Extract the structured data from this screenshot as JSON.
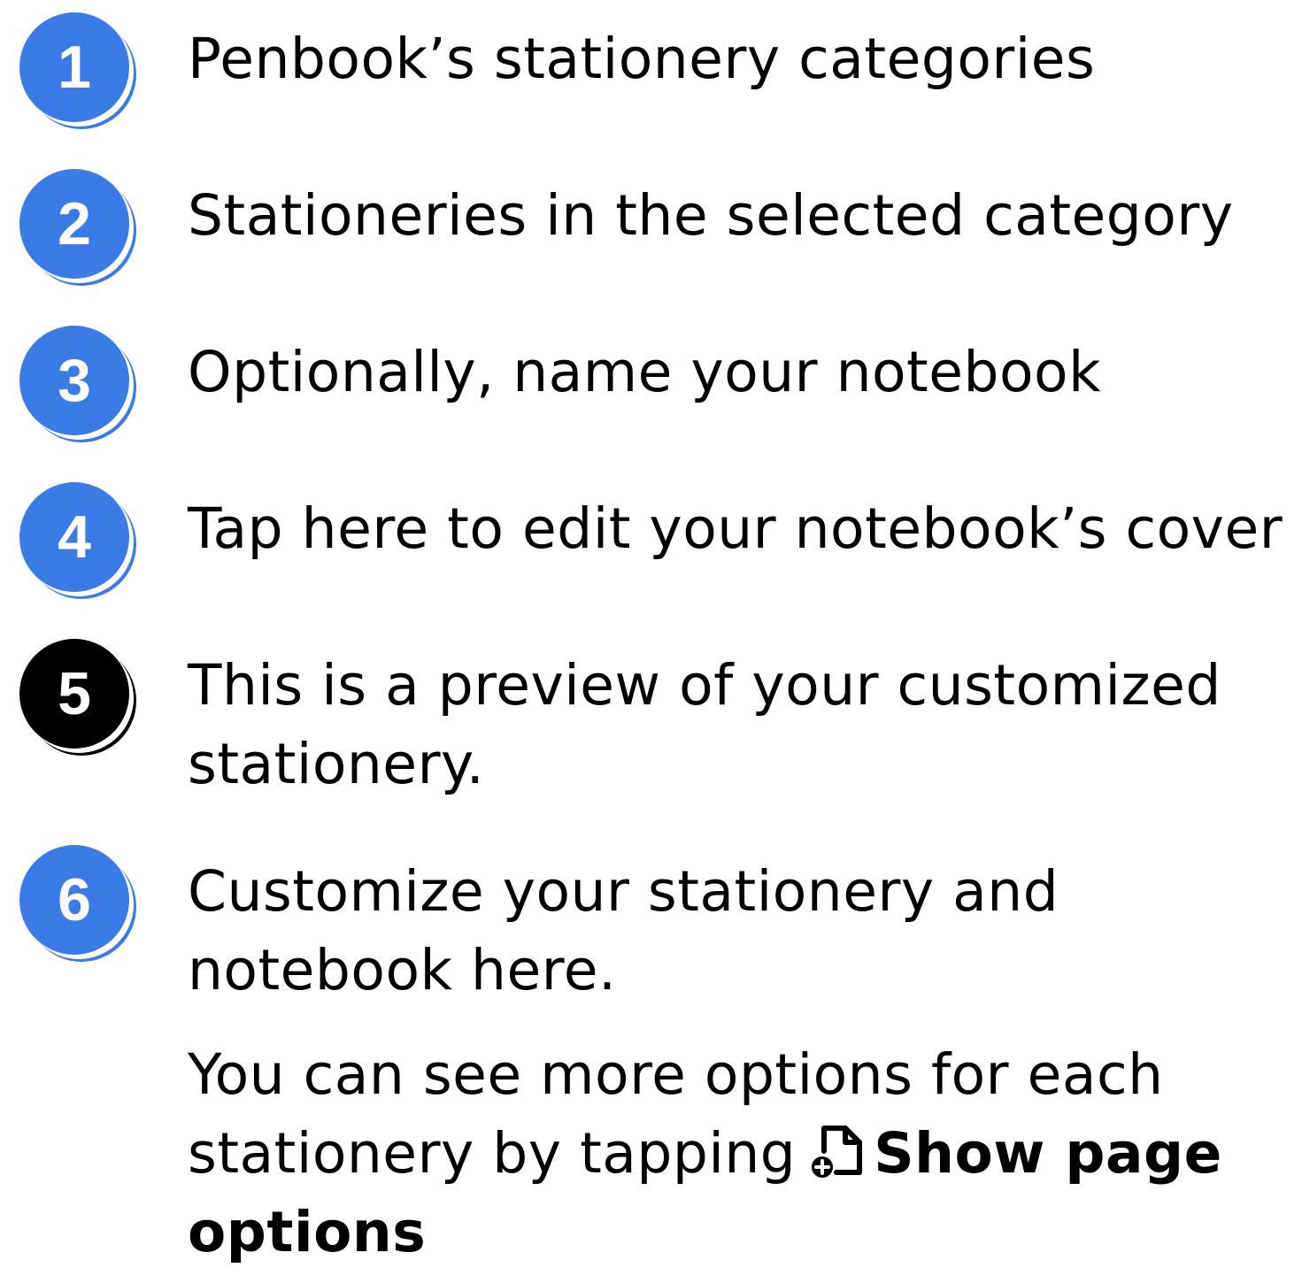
{
  "colors": {
    "badge_blue": "#3b7be6",
    "badge_black": "#000000",
    "text": "#000000"
  },
  "items": [
    {
      "number": "1",
      "color": "blue",
      "text": "Penbook’s stationery categories"
    },
    {
      "number": "2",
      "color": "blue",
      "text": "Stationeries in the selected category"
    },
    {
      "number": "3",
      "color": "blue",
      "text": "Optionally, name your notebook"
    },
    {
      "number": "4",
      "color": "blue",
      "text": "Tap here to edit your notebook’s cover"
    },
    {
      "number": "5",
      "color": "black",
      "text": "This is a preview of your customized stationery."
    },
    {
      "number": "6",
      "color": "blue",
      "text": "Customize your stationery and notebook here.",
      "note_prefix": "You can see more options for each stationery by tapping",
      "note_icon": "page-add-icon",
      "note_bold": "Show page options"
    }
  ]
}
